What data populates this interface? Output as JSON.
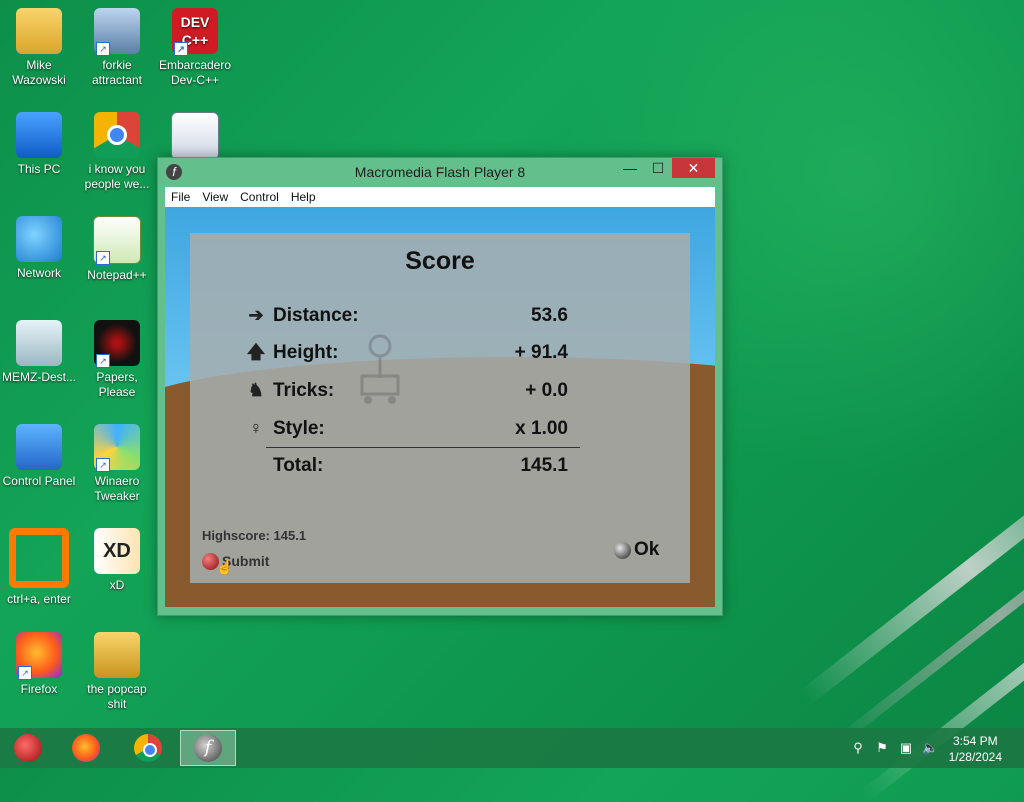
{
  "desktop": {
    "icons": [
      {
        "label": "Mike Wazowski",
        "icon": "folder-icon"
      },
      {
        "label": "forkie attractant",
        "icon": "settings-monitor-icon"
      },
      {
        "label": "Embarcadero Dev-C++",
        "icon": "devcpp-icon",
        "glyph_text": "DEV C++"
      },
      {
        "label": "This PC",
        "icon": "computer-icon"
      },
      {
        "label": "i know you people we...",
        "icon": "chrome-icon"
      },
      {
        "label": "",
        "icon": "webpage-icon"
      },
      {
        "label": "Network",
        "icon": "network-icon"
      },
      {
        "label": "Notepad++",
        "icon": "notepadpp-icon"
      },
      {
        "label": "MEMZ-Dest...",
        "icon": "recycle-bin-icon"
      },
      {
        "label": "Papers, Please",
        "icon": "papers-please-icon"
      },
      {
        "label": "Control Panel",
        "icon": "control-panel-icon"
      },
      {
        "label": "Winaero Tweaker",
        "icon": "winaero-icon"
      },
      {
        "label": "ctrl+a, enter",
        "icon": "orange-ring-icon"
      },
      {
        "label": "xD",
        "icon": "xd-icon",
        "glyph_text": "XD"
      },
      {
        "label": "Firefox",
        "icon": "firefox-icon"
      },
      {
        "label": "the popcap shit",
        "icon": "folder-icon"
      }
    ]
  },
  "window": {
    "title": "Macromedia Flash Player 8",
    "minimize_glyph": "—",
    "maximize_glyph": "☐",
    "close_glyph": "✕",
    "menu": [
      "File",
      "View",
      "Control",
      "Help"
    ]
  },
  "score": {
    "title": "Score",
    "rows": [
      {
        "icon": "arrow-right-icon",
        "glyph": "➔",
        "label": "Distance:",
        "value": "53.6"
      },
      {
        "icon": "arrow-up-icon",
        "glyph": "🡅",
        "label": "Height:",
        "value": "+ 91.4"
      },
      {
        "icon": "tricks-icon",
        "glyph": "♞",
        "label": "Tricks:",
        "value": "+ 0.0"
      },
      {
        "icon": "style-icon",
        "glyph": "♀",
        "label": "Style:",
        "value": "x 1.00"
      },
      {
        "icon": "",
        "glyph": "",
        "label": "Total:",
        "value": "145.1"
      }
    ],
    "highscore": "Highscore: 145.1",
    "submit_label": "Submit",
    "ok_label": "Ok"
  },
  "taskbar": {
    "flash_glyph": "f",
    "time": "3:54 PM",
    "date": "1/28/2024"
  },
  "colors": {
    "desktop_green": "#13a457",
    "window_frame": "#63c08d",
    "close_red": "#c7373a",
    "sky_blue": "#3ea6e0",
    "ground_brown": "#8b5a2b"
  }
}
